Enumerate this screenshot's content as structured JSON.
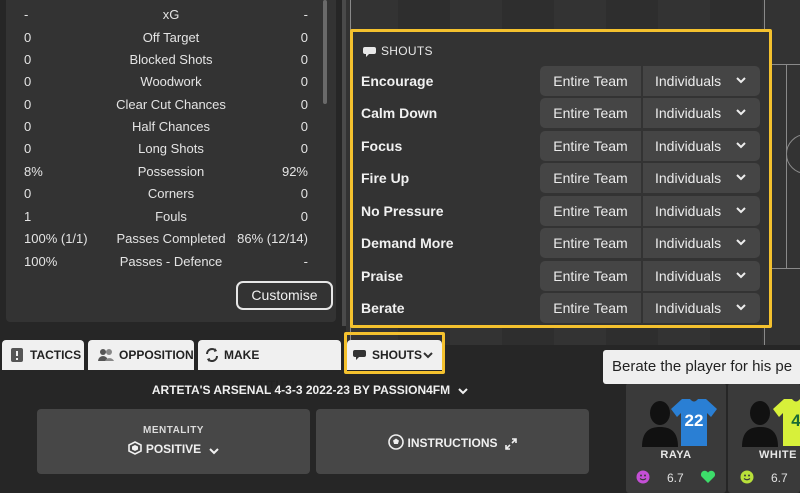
{
  "stats": {
    "rows": [
      {
        "left": "-",
        "label": "xG",
        "right": "-"
      },
      {
        "left": "0",
        "label": "Off Target",
        "right": "0"
      },
      {
        "left": "0",
        "label": "Blocked Shots",
        "right": "0"
      },
      {
        "left": "0",
        "label": "Woodwork",
        "right": "0"
      },
      {
        "left": "0",
        "label": "Clear Cut Chances",
        "right": "0"
      },
      {
        "left": "0",
        "label": "Half Chances",
        "right": "0"
      },
      {
        "left": "0",
        "label": "Long Shots",
        "right": "0"
      },
      {
        "left": "8%",
        "label": "Possession",
        "right": "92%"
      },
      {
        "left": "0",
        "label": "Corners",
        "right": "0"
      },
      {
        "left": "1",
        "label": "Fouls",
        "right": "0"
      },
      {
        "left": "100% (1/1)",
        "label": "Passes Completed",
        "right": "86% (12/14)"
      },
      {
        "left": "100%",
        "label": "Passes - Defence",
        "right": "-"
      }
    ],
    "customise_label": "Customise"
  },
  "shouts": {
    "title": "SHOUTS",
    "entire_team_label": "Entire Team",
    "individuals_label": "Individuals",
    "items": [
      "Encourage",
      "Calm Down",
      "Focus",
      "Fire Up",
      "No Pressure",
      "Demand More",
      "Praise",
      "Berate"
    ]
  },
  "tabs": {
    "tactics": "TACTICS",
    "opposition": "OPPOSITION",
    "substitution": "MAKE SUBSTITUTION",
    "shouts": "SHOUTS"
  },
  "tactic": {
    "name": "ARTETA'S ARSENAL 4-3-3 2022-23 BY PASSION4FM"
  },
  "mentality": {
    "label": "MENTALITY",
    "value": "POSITIVE"
  },
  "instructions": {
    "label": "INSTRUCTIONS"
  },
  "tooltip": {
    "text": "Berate the player for his pe"
  },
  "players": [
    {
      "name": "RAYA",
      "number": "22",
      "rating": "6.7",
      "shirt_color": "#2a7fd4",
      "number_color": "#ffffff"
    },
    {
      "name": "WHITE",
      "number": "4",
      "rating": "6.7",
      "shirt_color": "#d7f03a",
      "number_color": "#1a6b34"
    }
  ],
  "colors": {
    "highlight": "#f4c12e",
    "panel": "#333333",
    "button": "#454545",
    "morale_purple": "#c44fd6",
    "morale_green": "#3ddc6a",
    "morale_yellow": "#b8e03a"
  }
}
